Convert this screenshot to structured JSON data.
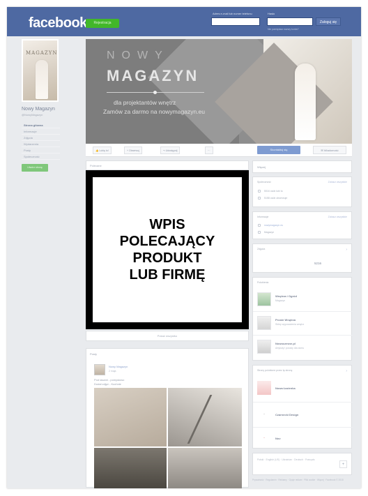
{
  "header": {
    "logo": "facebook",
    "signup_label": "Rejestracja",
    "email_label": "Adres e-mail lub numer telefonu",
    "password_label": "Hasło",
    "login_label": "Zaloguj się",
    "forgot_label": "Nie pamiętasz nazwy konta?"
  },
  "sidebar": {
    "page_name": "Nowy Magazyn",
    "page_handle": "@NowyMagazyn",
    "avatar_word": "MAGAZYN",
    "items": [
      {
        "label": "Strona główna"
      },
      {
        "label": "Informacje"
      },
      {
        "label": "Zdjęcia"
      },
      {
        "label": "Wydarzenia"
      },
      {
        "label": "Posty"
      },
      {
        "label": "Społeczność"
      }
    ],
    "create_page_label": "Utwórz stronę"
  },
  "cover": {
    "line1": "NOWY",
    "line2": "MAGAZYN",
    "tagline1": "dla projektantów wnętrz",
    "tagline2": "Zamów za darmo na nowymagazyn.eu"
  },
  "actions": {
    "like": "Lubię to!",
    "follow": "Obserwuj",
    "share": "Udostępnij",
    "more": "···",
    "contact": "Skontaktuj się",
    "message": "Wiadomość"
  },
  "main": {
    "posts_header": "Polecane",
    "overlay_text": "WPIS\nPOLECAJĄCY\nPRODUKT\nLUB FIRMĘ",
    "show_all": "Pokaż wszystko",
    "feed_title": "Posty",
    "post": {
      "author": "Nowy Magazyn",
      "time": "2 maja",
      "line1": "Pod lasami - pomysłowo",
      "line2": "Dodał zdjęć - Kuchnie"
    }
  },
  "right": {
    "about_header": "Więcej",
    "community_title": "Społeczność",
    "community_link": "Zobacz wszystkie",
    "community_lines": [
      "5016 osób lubi to",
      "5158 osób obserwuje"
    ],
    "info_title": "Informacje",
    "info_link": "Zobacz wszystkie",
    "info_lines": [
      "nowymagazyn.eu",
      "Magazyn"
    ],
    "photos_title": "Zdjęcia",
    "photos_count": "5216",
    "likes_title": "Polubienia",
    "suggestions": [
      {
        "name": "Wnętrza i Ogród",
        "sub": "Magazyn"
      },
      {
        "name": "Proste Wnętrza",
        "sub": "Sklep wyposażenia wnętrz"
      },
      {
        "name": "Nowoczesne.pl",
        "sub": "Artykuły i porady dla domu"
      }
    ],
    "partners_title": "Strony polubione przez tę stronę",
    "partners": [
      {
        "name": "Nowa Łazienka"
      },
      {
        "name": "Czarnecki Design"
      },
      {
        "name": "Nov"
      }
    ],
    "footer_text": "Polski · English (US) · Ukrainian · Deutsch · Français",
    "legal": "Prywatność · Regulamin · Reklamy · Opcje reklam · Pliki cookie · Więcej · Facebook © 2018"
  },
  "colors": {
    "header_bg": "#4e69a2",
    "page_bg": "#e9ebee",
    "overlay_border": "#000000",
    "signup_green": "#42b72a"
  }
}
